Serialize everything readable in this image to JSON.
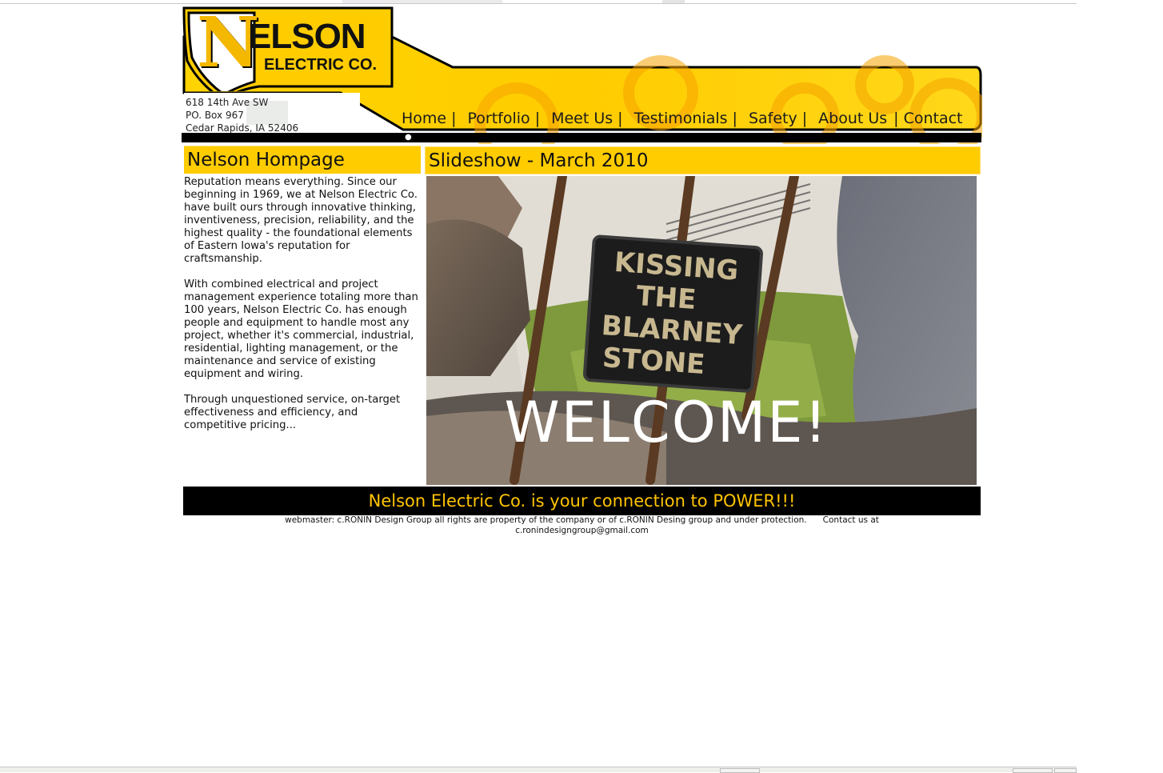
{
  "colors": {
    "accent_yellow": "#ffcc00",
    "banner_black": "#000000",
    "slogan_text": "#ffc400"
  },
  "logo": {
    "initial": "N",
    "name_rest": "ELSON",
    "subtitle": "ELECTRIC CO."
  },
  "address": {
    "line1": "618 14th Ave SW",
    "line2": "PO. Box 967",
    "line3": "Cedar Rapids, IA 52406"
  },
  "nav": {
    "items": [
      {
        "label": "Home",
        "sep": "|"
      },
      {
        "label": "Portfolio",
        "sep": "|"
      },
      {
        "label": "Meet Us",
        "sep": "|"
      },
      {
        "label": "Testimonials",
        "sep": "|"
      },
      {
        "label": "Safety",
        "sep": "|"
      },
      {
        "label": "About Us",
        "sep": "|"
      },
      {
        "label": "Contact",
        "sep": ""
      }
    ]
  },
  "left_panel": {
    "title": "Nelson Hompage",
    "paragraphs": [
      "Reputation means everything. Since our beginning in 1969, we at Nelson Electric Co. have built ours through innovative thinking, inventiveness, precision, reliability, and the highest quality - the foundational elements of Eastern Iowa's reputation for craftsmanship.",
      "With combined electrical and project management experience totaling more than 100 years, Nelson Electric Co. has enough people and equipment to handle most any project, whether it's commercial, industrial, residential, lighting management, or the maintenance and service of existing equipment and wiring.",
      "Through unquestioned service, on-target effectiveness and efficiency, and competitive pricing..."
    ]
  },
  "slideshow": {
    "title": "Slideshow - March 2010",
    "sign_line1": "KISSING",
    "sign_line2": "THE",
    "sign_line3": "BLARNEY",
    "sign_line4": "STONE",
    "overlay": "WELCOME!"
  },
  "footer": {
    "slogan": "Nelson Electric Co. is your connection to POWER!!!",
    "credits": "webmaster: c.RONIN Design Group all rights are property of the company or of c.RONIN Desing group and under protection.",
    "contact_label": "Contact us at",
    "email": "c.ronindesigngroup@gmail.com"
  }
}
